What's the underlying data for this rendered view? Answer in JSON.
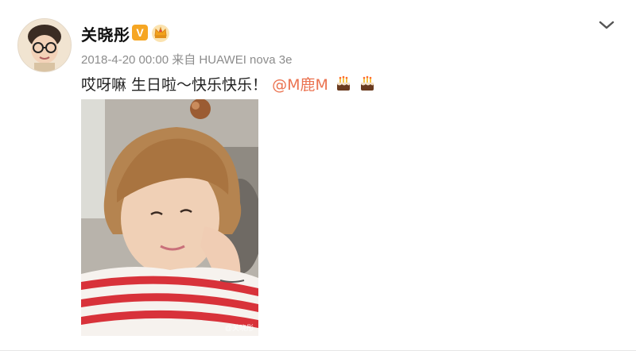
{
  "post": {
    "username": "关晓彤",
    "verified_badge": "V",
    "crown_icon": "crown-icon",
    "meta": "2018-4-20 00:00 来自 HUAWEI nova 3e",
    "text_before": "哎呀嘛 生日啦～快乐快乐！",
    "mention": "@M鹿M",
    "emoji": [
      "cake-icon",
      "cake-icon"
    ],
    "image_watermark": "@关晓彤"
  },
  "colors": {
    "mention": "#eb7350",
    "meta": "#8c8c8c",
    "badge": "#f6a623"
  }
}
